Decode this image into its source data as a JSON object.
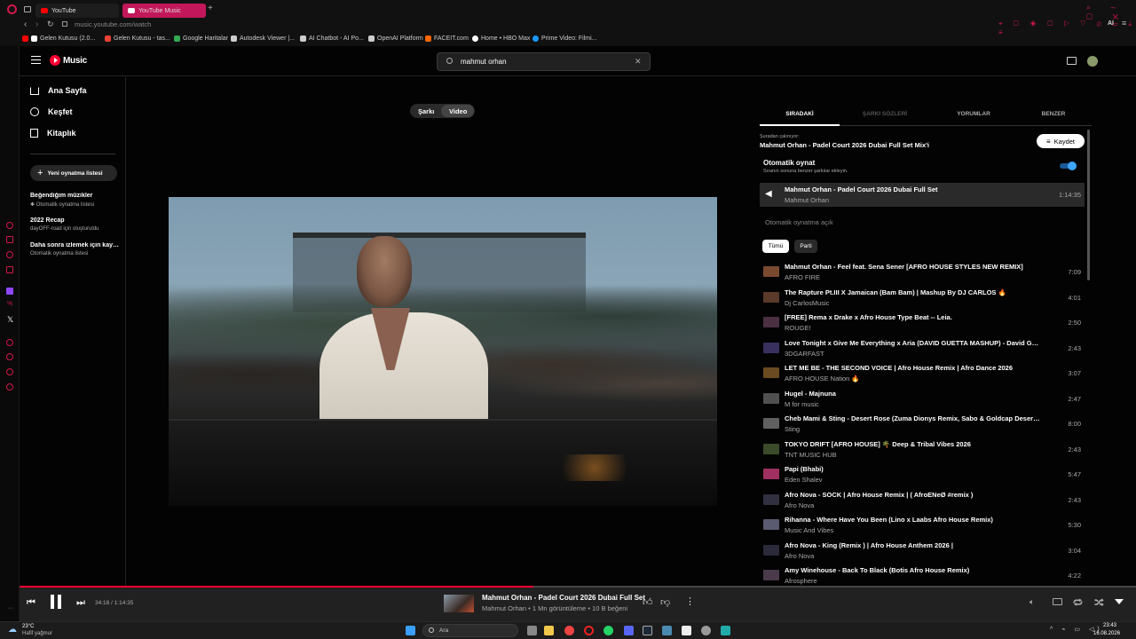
{
  "browser": {
    "tabs": [
      {
        "label": "YouTube"
      },
      {
        "label": "YouTube Music"
      }
    ],
    "address": "music.youtube.com/watch",
    "bookmarks": [
      "Gelen Kutusu (2.0...",
      "Gelen Kutusu - tas...",
      "Google Haritalar",
      "Autodesk Viewer |...",
      "AI Chatbot - AI Po...",
      "OpenAI Platform",
      "FACEIT.com",
      "Home • HBO Max",
      "Prime Video: Filmi..."
    ],
    "ext_label": "AI"
  },
  "header": {
    "logo": "Music",
    "search_value": "mahmut orhan"
  },
  "sidebar": {
    "nav": [
      {
        "label": "Ana Sayfa"
      },
      {
        "label": "Keşfet"
      },
      {
        "label": "Kitaplık"
      }
    ],
    "new_playlist": "Yeni oynatma listesi",
    "library": [
      {
        "title": "Beğendiğim müzikler",
        "sub": "Otomatik oynatma listesi"
      },
      {
        "title": "2022 Recap",
        "sub": "dayOFF-road için oluşturuldu"
      },
      {
        "title": "Daha sonra izlemek için kayd...",
        "sub": "Otomatik oynatma listesi"
      }
    ]
  },
  "toggle": {
    "song": "Şarkı",
    "video": "Video"
  },
  "queue_tabs": [
    "SIRADAKİ",
    "ŞARKI SÖZLERİ",
    "YORUMLAR",
    "BENZER"
  ],
  "playing_from": {
    "label": "Şuradan çalınıyor:",
    "title": "Mahmut Orhan - Padel Court 2026 Dubai Full Set Mix'i",
    "save": "Kaydet"
  },
  "autoplay": {
    "title": "Otomatik oynat",
    "sub": "Sıranın sonuna benzer şarkılar ekleyin.",
    "on_label": "Otomatik oynatma açık"
  },
  "current": {
    "title": "Mahmut Orhan - Padel Court 2026 Dubai Full Set",
    "artist": "Mahmut Orhan",
    "duration": "1:14:35"
  },
  "chips": [
    "Tümü",
    "Parti"
  ],
  "queue": [
    {
      "title": "Mahmut Orhan - Feel feat. Sena Sener [AFRO HOUSE STYLES NEW REMIX]",
      "artist": "AFRO FIRE",
      "dur": "7:09"
    },
    {
      "title": "The Rapture Pt.III X Jamaican (Bam Bam) | Mashup By DJ CARLOS 🔥",
      "artist": "Dj CarlosMusic",
      "dur": "4:01"
    },
    {
      "title": "[FREE] Rema x Drake x Afro House Type Beat -- Leia.",
      "artist": "ROUGE!",
      "dur": "2:50"
    },
    {
      "title": "Love Tonight x Give Me Everything x Aria (DAVID GUETTA MASHUP) - David Guetta, Sh...",
      "artist": "3DGARFAST",
      "dur": "2:43"
    },
    {
      "title": "LET ME BE - THE SECOND VOICE | Afro House Remix | Afro Dance 2026",
      "artist": "AFRO HOUSE Nation 🔥",
      "dur": "3:07"
    },
    {
      "title": "Hugel - Majnuna",
      "artist": "M for music",
      "dur": "2:47"
    },
    {
      "title": "Cheb Mami & Sting - Desert Rose (Zuma Dionys Remix, Sabo & Goldcap Desert Sunrise...",
      "artist": "Sting",
      "dur": "8:00"
    },
    {
      "title": "TOKYO DRIFT [AFRO HOUSE] 🌴 Deep & Tribal Vibes 2026",
      "artist": "TNT MUSIC HUB",
      "dur": "2:43"
    },
    {
      "title": "Papi (Bhabi)",
      "artist": "Eden Shalev",
      "dur": "5:47"
    },
    {
      "title": "Afro Nova - SOCK | Afro House Remix | ( AfroENeØ #remix )",
      "artist": "Afro Nova",
      "dur": "2:43"
    },
    {
      "title": "Rihanna - Where Have You Been (Lino x Laabs Afro House Remix)",
      "artist": "Music And Vibes",
      "dur": "5:30"
    },
    {
      "title": "Afro Nova - King (Remix ) | Afro House Anthem 2026 |",
      "artist": "Afro Nova",
      "dur": "3:04"
    },
    {
      "title": "Amy Winehouse - Back To Black (Botis Afro House Remix)",
      "artist": "Afrosphere",
      "dur": "4:22"
    }
  ],
  "player": {
    "time": "34:18 / 1:14:35",
    "progress": 0.46,
    "title": "Mahmut Orhan - Padel Court 2026 Dubai Full Set",
    "meta": "Mahmut Orhan • 1 Mn görüntüleme • 10 B beğeni"
  },
  "taskbar": {
    "weather_temp": "23°C",
    "weather_desc": "Hafif yağmur",
    "search": "Ara",
    "time": "23:43",
    "date": "16.08.2026"
  },
  "colors": {
    "accent": "#ff0033",
    "brand": "#d0184a",
    "toggle": "#3ea6ff"
  }
}
